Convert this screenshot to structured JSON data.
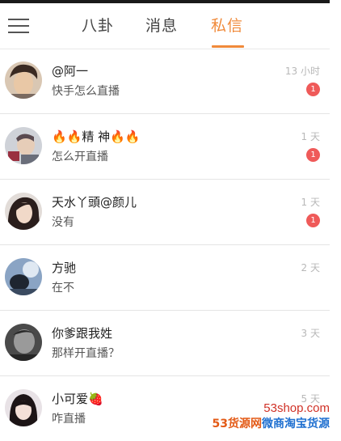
{
  "tabs": [
    {
      "label": "八卦",
      "active": false
    },
    {
      "label": "消息",
      "active": false
    },
    {
      "label": "私信",
      "active": true
    }
  ],
  "accent_color": "#f08a3a",
  "badge_color": "#ef5a59",
  "conversations": [
    {
      "name": "@阿一",
      "message": "快手怎么直播",
      "time": "13 小时",
      "unread": "1"
    },
    {
      "name": "🔥🔥精 神🔥🔥",
      "message": "怎么开直播",
      "time": "1 天",
      "unread": "1"
    },
    {
      "name": "天水丫頭@颜儿",
      "message": "没有",
      "time": "1 天",
      "unread": "1"
    },
    {
      "name": "方驰",
      "message": "在不",
      "time": "2 天",
      "unread": ""
    },
    {
      "name": "你爹跟我姓",
      "message": "那样开直播？",
      "time": "3 天",
      "unread": ""
    },
    {
      "name": "小可爱🍓",
      "message": "咋直播",
      "time": "5 天",
      "unread": ""
    }
  ],
  "watermark": {
    "domain": "53shop.com",
    "brand": "53货源网",
    "slogan": "微商淘宝货源"
  }
}
